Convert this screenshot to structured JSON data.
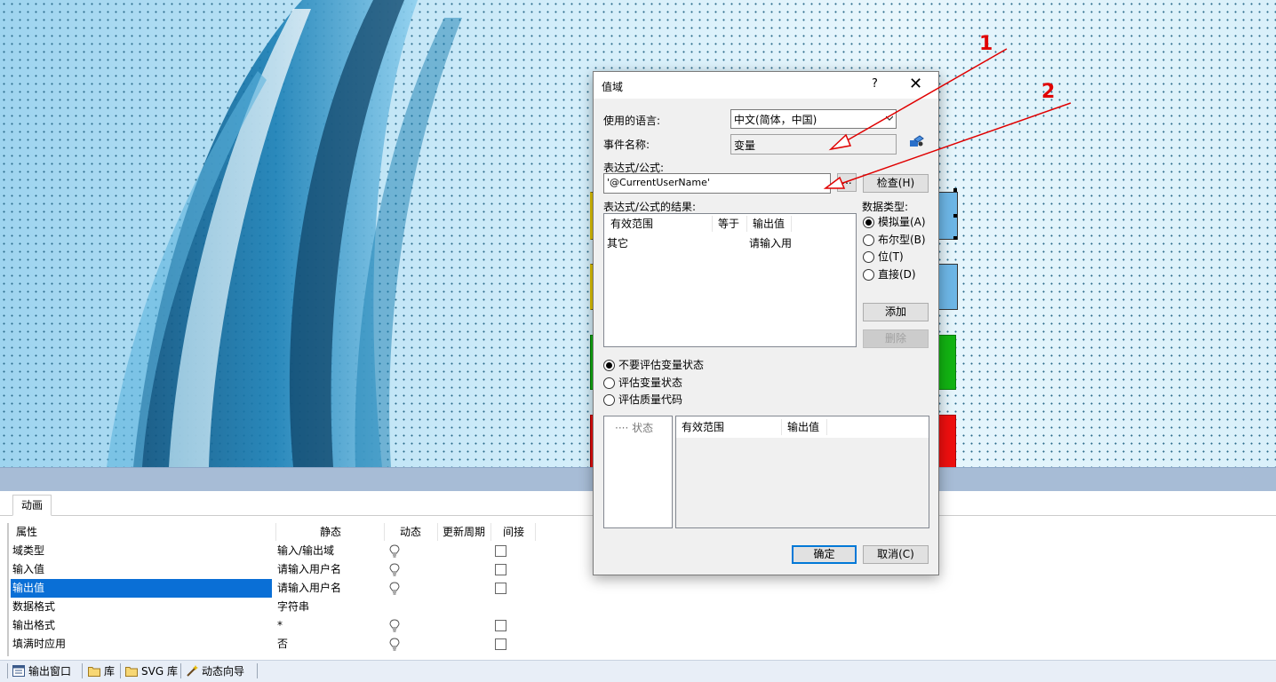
{
  "dialog": {
    "title": "值域",
    "help": "?",
    "close": "✕",
    "language_label": "使用的语言:",
    "language_value": "中文(简体，中国)",
    "event_label": "事件名称:",
    "event_value": "变量",
    "expr_label": "表达式/公式:",
    "expr_value": "'@CurrentUserName'",
    "expr_browse": "...",
    "check_button": "检查(H)",
    "result_label": "表达式/公式的结果:",
    "result_headers": [
      "有效范围",
      "等于",
      "输出值"
    ],
    "result_rows": [
      {
        "range": "其它",
        "output": "请输入用"
      }
    ],
    "datatype_label": "数据类型:",
    "datatypes": [
      {
        "label": "模拟量(A)",
        "checked": true
      },
      {
        "label": "布尔型(B)",
        "checked": false
      },
      {
        "label": "位(T)",
        "checked": false
      },
      {
        "label": "直接(D)",
        "checked": false
      }
    ],
    "add_button": "添加",
    "delete_button": "删除",
    "eval_options": [
      {
        "label": "不要评估变量状态",
        "checked": true
      },
      {
        "label": "评估变量状态",
        "checked": false
      },
      {
        "label": "评估质量代码",
        "checked": false
      }
    ],
    "status_tree_item": "状态",
    "status_headers": [
      "有效范围",
      "输出值"
    ],
    "ok_button": "确定",
    "cancel_button": "取消(C)"
  },
  "properties": {
    "tab": "动画",
    "headers": [
      "属性",
      "静态",
      "动态",
      "更新周期",
      "间接"
    ],
    "rows": [
      {
        "name": "域类型",
        "static": "输入/输出域",
        "dynamic": true,
        "indirect": true,
        "selected": false
      },
      {
        "name": "输入值",
        "static": "请输入用户名",
        "dynamic": true,
        "indirect": true,
        "selected": false
      },
      {
        "name": "输出值",
        "static": "请输入用户名",
        "dynamic": true,
        "indirect": true,
        "selected": true
      },
      {
        "name": "数据格式",
        "static": "字符串",
        "dynamic": false,
        "indirect": false,
        "selected": false
      },
      {
        "name": "输出格式",
        "static": "*",
        "dynamic": true,
        "indirect": true,
        "selected": false
      },
      {
        "name": "填满时应用",
        "static": "否",
        "dynamic": true,
        "indirect": true,
        "selected": false
      }
    ]
  },
  "bottom_tabs": [
    {
      "label": "输出窗口",
      "icon": "output-window-icon"
    },
    {
      "label": "库",
      "icon": "folder-icon"
    },
    {
      "label": "SVG 库",
      "icon": "folder-icon"
    },
    {
      "label": "动态向导",
      "icon": "wand-icon"
    }
  ],
  "annotations": {
    "marker1": "1",
    "marker2": "2",
    "color": "#e00000"
  },
  "colors": {
    "selection": "#0a6fd6",
    "canvas": "#c9e9f6"
  }
}
